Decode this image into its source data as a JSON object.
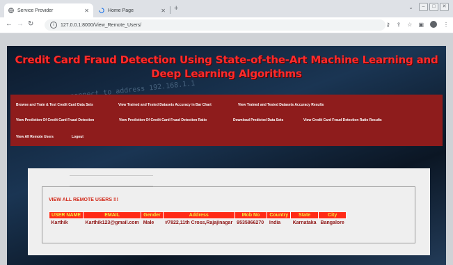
{
  "browser": {
    "tabs": [
      {
        "title": "Service Provider",
        "active": true
      },
      {
        "title": "Home Page",
        "active": false
      }
    ],
    "new_tab_label": "+",
    "url": "127.0.0.1:8000/View_Remote_Users/"
  },
  "header": {
    "title": "Credit Card Fraud Detection Using State-of-the-Art Machine Learning and Deep Learning Algorithms",
    "background_text": "connect to address 192.168.1.1",
    "title_color": "#ff2b2b"
  },
  "menu": {
    "items": [
      "Browse and Train & Test Credit Card Data Sets",
      "View Trained and Tested Datasets Accuracy in Bar Chart",
      "View Trained and Tested Datasets Accuracy Results",
      "View Prediction Of Credit Card Fraud Detection",
      "View Prediction Of Credit Card Fraud Detection Ratio",
      "Download Predicted Data Sets",
      "View Credit Card Fraud Detection Ratio Results",
      "View All Remote Users",
      "Logout"
    ],
    "background": "#8e1c1c"
  },
  "users": {
    "heading": "VIEW ALL REMOTE USERS !!!",
    "columns": [
      "USER NAME",
      "EMAIL",
      "Gender",
      "Address",
      "Mob No",
      "Country",
      "State",
      "City"
    ],
    "rows": [
      [
        "Karthik",
        "Karthik123@gmail.com",
        "Male",
        "#7822,11th Cross,Rajajinagar",
        "9535866270",
        "India",
        "Karnataka",
        "Bangalore"
      ]
    ],
    "header_bg": "#ff2a16",
    "header_text": "#f4ea3c"
  }
}
